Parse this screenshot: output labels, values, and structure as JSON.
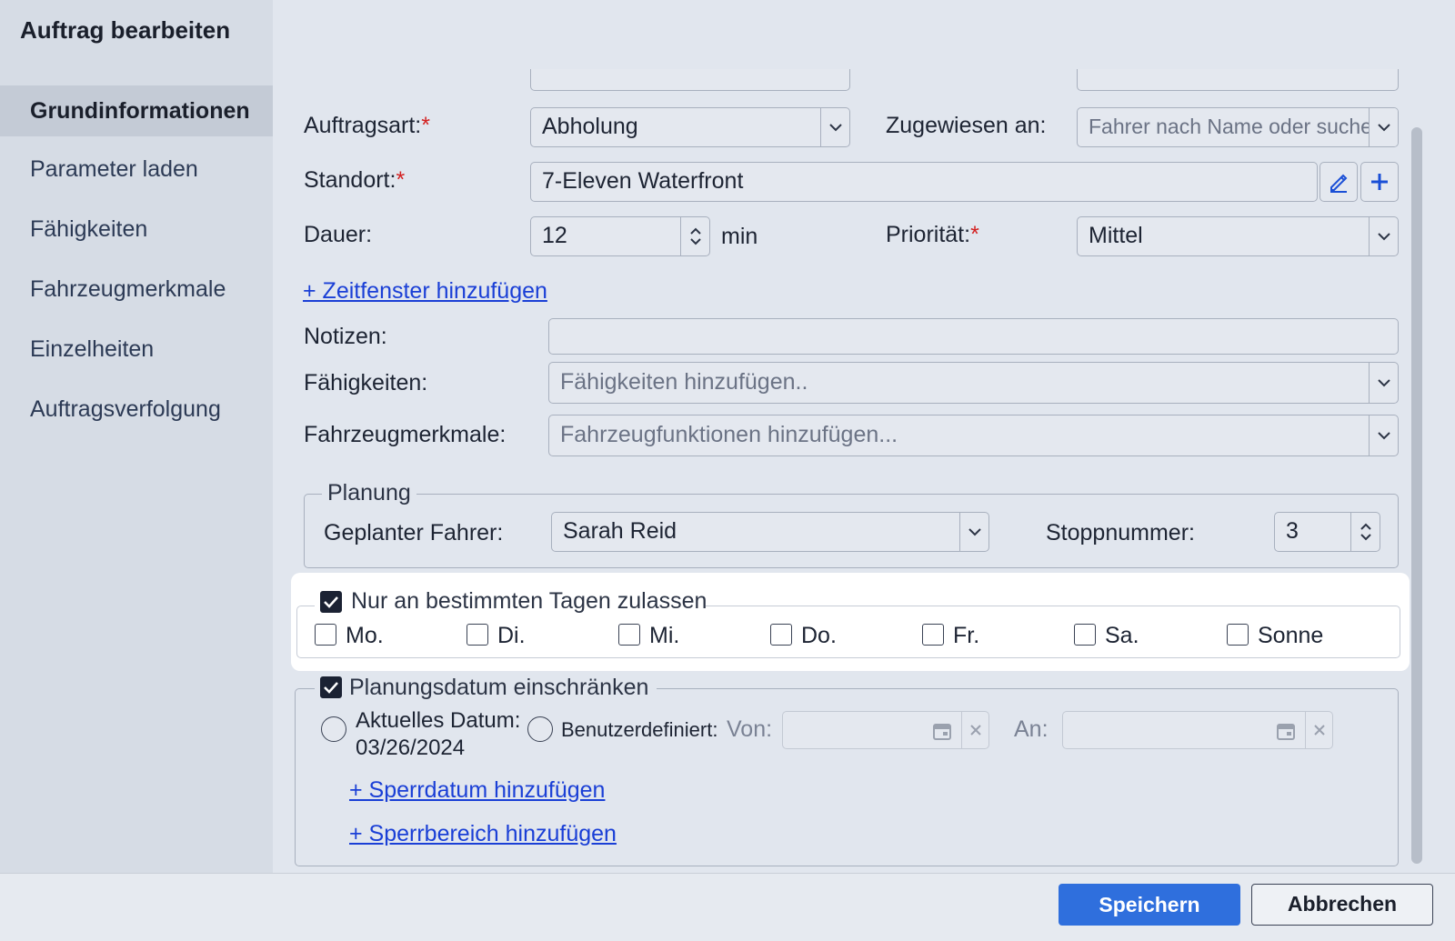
{
  "dialog": {
    "title": "Auftrag bearbeiten"
  },
  "sidebar": {
    "items": [
      {
        "label": "Grundinformationen",
        "active": true
      },
      {
        "label": "Parameter laden"
      },
      {
        "label": "Fähigkeiten"
      },
      {
        "label": "Fahrzeugmerkmale"
      },
      {
        "label": "Einzelheiten"
      },
      {
        "label": "Auftragsverfolgung"
      }
    ]
  },
  "form": {
    "order_type": {
      "label": "Auftragsart:",
      "required_mark": "*",
      "value": "Abholung"
    },
    "assigned_to": {
      "label": "Zugewiesen an:",
      "placeholder": "Fahrer nach Name oder suchen"
    },
    "location": {
      "label": "Standort:",
      "required_mark": "*",
      "value": "7-Eleven Waterfront"
    },
    "duration": {
      "label": "Dauer:",
      "value": "12",
      "unit": "min"
    },
    "priority": {
      "label": "Priorität:",
      "required_mark": "*",
      "value": "Mittel"
    },
    "add_time_window": "+ Zeitfenster hinzufügen",
    "notes": {
      "label": "Notizen:",
      "value": ""
    },
    "capabilities": {
      "label": "Fähigkeiten:",
      "placeholder": "Fähigkeiten hinzufügen.."
    },
    "vehicle_features": {
      "label": "Fahrzeugmerkmale:",
      "placeholder": "Fahrzeugfunktionen hinzufügen..."
    }
  },
  "planning": {
    "legend": "Planung",
    "driver": {
      "label": "Geplanter Fahrer:",
      "value": "Sarah Reid"
    },
    "stop_number": {
      "label": "Stoppnummer:",
      "value": "3"
    }
  },
  "days": {
    "legend": "Nur an bestimmten Tagen zulassen",
    "checked": true,
    "items": [
      {
        "label": "Mo.",
        "checked": false
      },
      {
        "label": "Di.",
        "checked": false
      },
      {
        "label": "Mi.",
        "checked": false
      },
      {
        "label": "Do.",
        "checked": false
      },
      {
        "label": "Fr.",
        "checked": false
      },
      {
        "label": "Sa.",
        "checked": false
      },
      {
        "label": "Sonne",
        "checked": false
      }
    ]
  },
  "date_restrict": {
    "legend": "Planungsdatum einschränken",
    "checked": true,
    "current_date_label": "Aktuelles Datum:",
    "current_date_value": "03/26/2024",
    "custom_label": "Benutzerdefiniert:",
    "from_label": "Von:",
    "to_label": "An:",
    "add_blackout_date": "+ Sperrdatum hinzufügen",
    "add_blackout_area": "+ Sperrbereich hinzufügen"
  },
  "footer": {
    "save": "Speichern",
    "cancel": "Abbrechen"
  },
  "colors": {
    "accent": "#2f6fdd",
    "link": "#1a3fd6",
    "required": "#d32020"
  }
}
